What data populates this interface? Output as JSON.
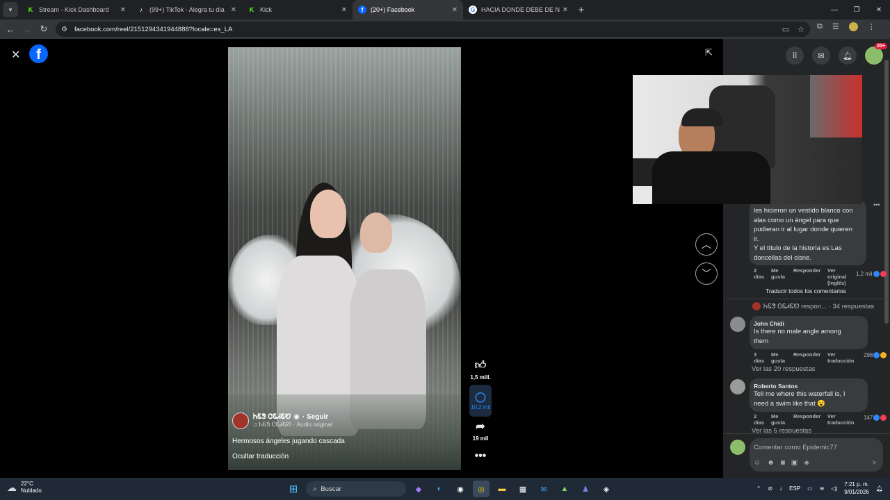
{
  "browser": {
    "tabs": [
      {
        "title": "Stream - Kick Dashboard",
        "favicon": "K",
        "color": "#53fc18",
        "active": false
      },
      {
        "title": "(99+) TikTok - Alegra tu día",
        "favicon": "♪",
        "color": "#ffffff",
        "active": false
      },
      {
        "title": "Kick",
        "favicon": "K",
        "color": "#53fc18",
        "active": false
      },
      {
        "title": "(20+) Facebook",
        "favicon": "f",
        "color": "#0866ff",
        "active": true
      },
      {
        "title": "HACIA DONDE DEBE DE NADAR",
        "favicon": "G",
        "color": "#ffffff",
        "active": false
      }
    ],
    "url": "facebook.com/reel/2151294341944888?locale=es_LA"
  },
  "reel": {
    "author": "ᏂᏋᏕ ᏣᏋᏗᏋᏬ",
    "follow": "· Seguir",
    "audio": "♫ ᏂᏋᏕ ᏣᏋᏗᏋᏬ · Audio original",
    "caption": "Hermosos ángeles jugando cascada",
    "translate_toggle": "Ocultar traducción",
    "likes": "1,5 mill.",
    "comments": "10,2 mil",
    "shares": "19 mil"
  },
  "panel": {
    "notif_count": "20+",
    "comment1_text": [
      "les hicieron un vestido blanco con",
      "alas como un ángel para que",
      "pudieran ir al lugar donde quieren",
      "ir.",
      "Y el título de la historia es Las",
      "doncellas del cisne."
    ],
    "comment1_meta": {
      "time": "2 días",
      "like": "Me gusta",
      "reply": "Responder",
      "original": "Ver original (Inglés)",
      "reactions": "1,2 mil"
    },
    "translate_all": "Traducir todos los comentarios",
    "reply_thread": "ᏂᏋᏕ ᏣᏋᏗᏋᏬ respon... · 34 respuestas",
    "comment2": {
      "author": "John Chidi",
      "text": [
        "Is there no male angle among",
        "them"
      ],
      "time": "3 días",
      "like": "Me gusta",
      "reply": "Responder",
      "translation": "Ver traducción",
      "reactions": "298",
      "replies": "Ver las 20 respuestas"
    },
    "comment3": {
      "author": "Roberto Santos",
      "text": [
        "Tell me where this waterfall is, I",
        "need a swim like that 😮"
      ],
      "time": "2 días",
      "like": "Me gusta",
      "reply": "Responder",
      "translation": "Ver traducción",
      "reactions": "147",
      "replies": "Ver las 5 respuestas"
    },
    "comment_placeholder": "Comentar como Epidemic77"
  },
  "taskbar": {
    "temp": "22°C",
    "weather": "Nublado",
    "search": "Buscar",
    "lang": "ESP",
    "time": "7:21 p. m.",
    "date": "9/01/2026"
  },
  "colors": {
    "accent": "#0866ff",
    "panel": "#242526",
    "taskbar": "#1f2a36"
  }
}
